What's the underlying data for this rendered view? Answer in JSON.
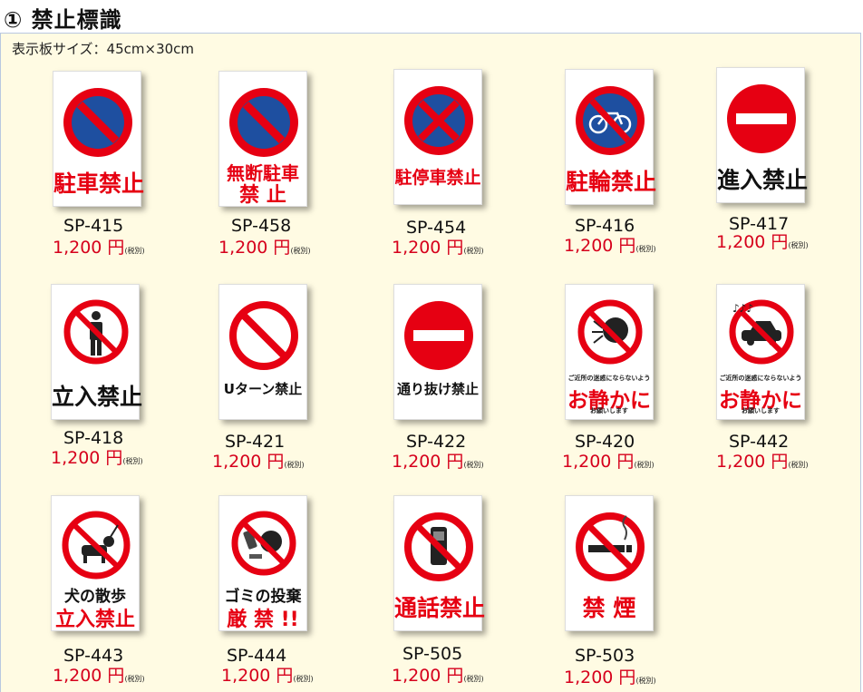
{
  "header": {
    "title": "① 禁止標識"
  },
  "size_note": "表示板サイズ：45cm×30cm",
  "tax_note": "(税別)",
  "colors": {
    "red": "#e60012",
    "blue": "#1e4fa0",
    "price_red": "#d6001c",
    "panel_bg": "#fffbe3"
  },
  "signs": [
    {
      "code": "SP-415",
      "price": "1,200 円",
      "pict": "parking-prohibited-icon",
      "text": "駐車禁止"
    },
    {
      "code": "SP-458",
      "price": "1,200 円",
      "pict": "parking-prohibited-icon",
      "text": "無断駐車",
      "text2": "禁 止"
    },
    {
      "code": "SP-454",
      "price": "1,200 円",
      "pict": "no-stopping-icon",
      "text": "駐停車禁止"
    },
    {
      "code": "SP-416",
      "price": "1,200 円",
      "pict": "no-bicycle-parking-icon",
      "text": "駐輪禁止"
    },
    {
      "code": "SP-417",
      "price": "1,200 円",
      "pict": "no-entry-icon",
      "text": "進入禁止"
    },
    {
      "code": "SP-418",
      "price": "1,200 円",
      "pict": "no-person-icon",
      "text": "立入禁止"
    },
    {
      "code": "SP-421",
      "price": "1,200 円",
      "pict": "no-u-turn-icon",
      "text": "Uターン禁止"
    },
    {
      "code": "SP-422",
      "price": "1,200 円",
      "pict": "no-entry-icon",
      "text": "通り抜け禁止"
    },
    {
      "code": "SP-420",
      "price": "1,200 円",
      "pict": "no-shouting-icon",
      "small": "ご近所の迷惑にならないよう",
      "text": "お静かに",
      "small2": "お願いします"
    },
    {
      "code": "SP-442",
      "price": "1,200 円",
      "pict": "no-car-noise-icon",
      "small": "ご近所の迷惑にならないよう",
      "text": "お静かに",
      "small2": "お願いします"
    },
    {
      "code": "SP-443",
      "price": "1,200 円",
      "pict": "no-dog-icon",
      "text": "犬の散歩",
      "text2": "立入禁止"
    },
    {
      "code": "SP-444",
      "price": "1,200 円",
      "pict": "no-dumping-icon",
      "text": "ゴミの投棄",
      "text2": "厳 禁 !!"
    },
    {
      "code": "SP-505",
      "price": "1,200 円",
      "pict": "no-phone-icon",
      "text": "通話禁止"
    },
    {
      "code": "SP-503",
      "price": "1,200 円",
      "pict": "no-smoking-icon",
      "text": "禁 煙"
    }
  ]
}
